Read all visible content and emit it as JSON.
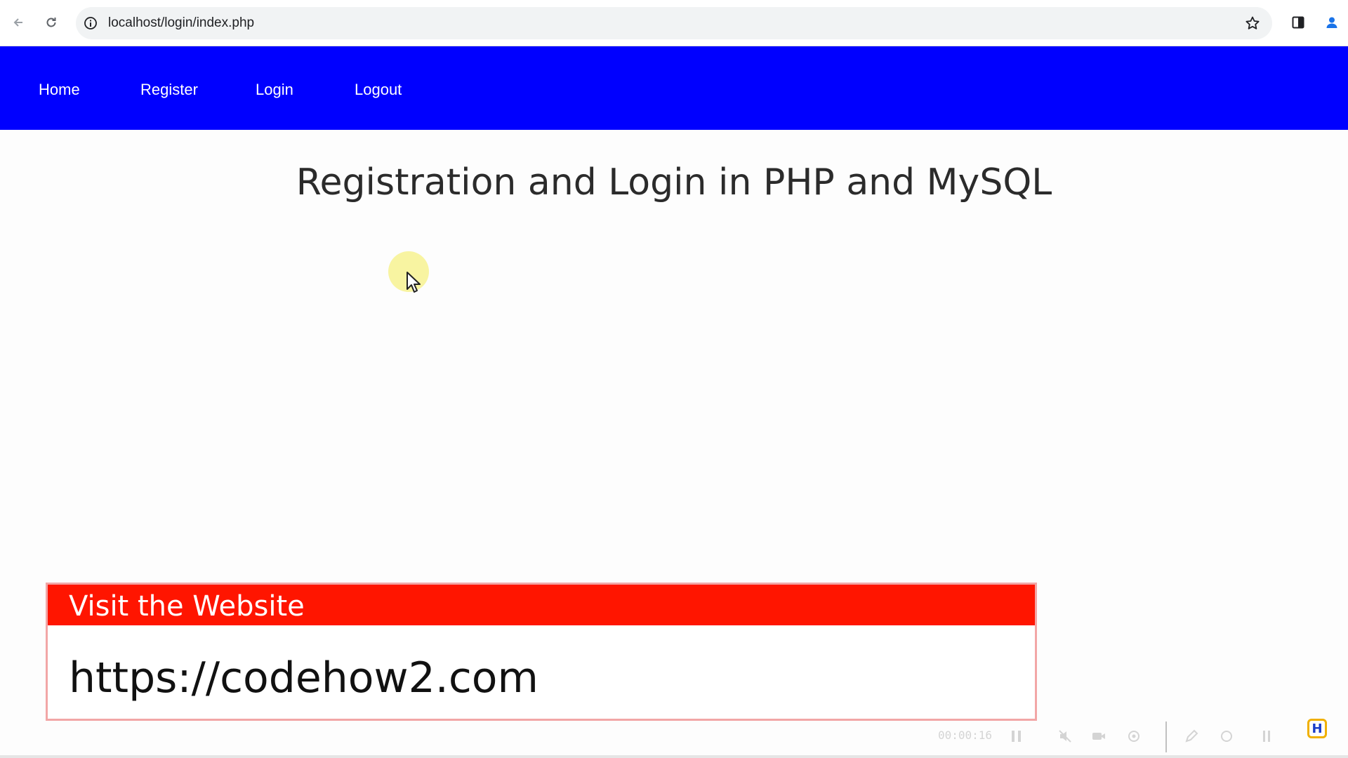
{
  "browser": {
    "url": "localhost/login/index.php",
    "icons": [
      "back-icon",
      "reload-icon",
      "info-icon",
      "star-icon",
      "side-panel-icon",
      "profile-icon"
    ]
  },
  "nav": {
    "items": [
      {
        "label": "Home"
      },
      {
        "label": "Register"
      },
      {
        "label": "Login"
      },
      {
        "label": "Logout"
      }
    ],
    "background": "#0000ff",
    "text_color": "#ffffff"
  },
  "page": {
    "title": "Registration and Login in PHP and MySQL"
  },
  "banner": {
    "title": "Visit the Website",
    "url": "https://codehow2.com",
    "header_color": "#ff1500",
    "border_color": "#f2a6a6"
  },
  "recorder": {
    "timer": "00:00:16"
  },
  "brand_logo": {
    "letter": "H"
  }
}
